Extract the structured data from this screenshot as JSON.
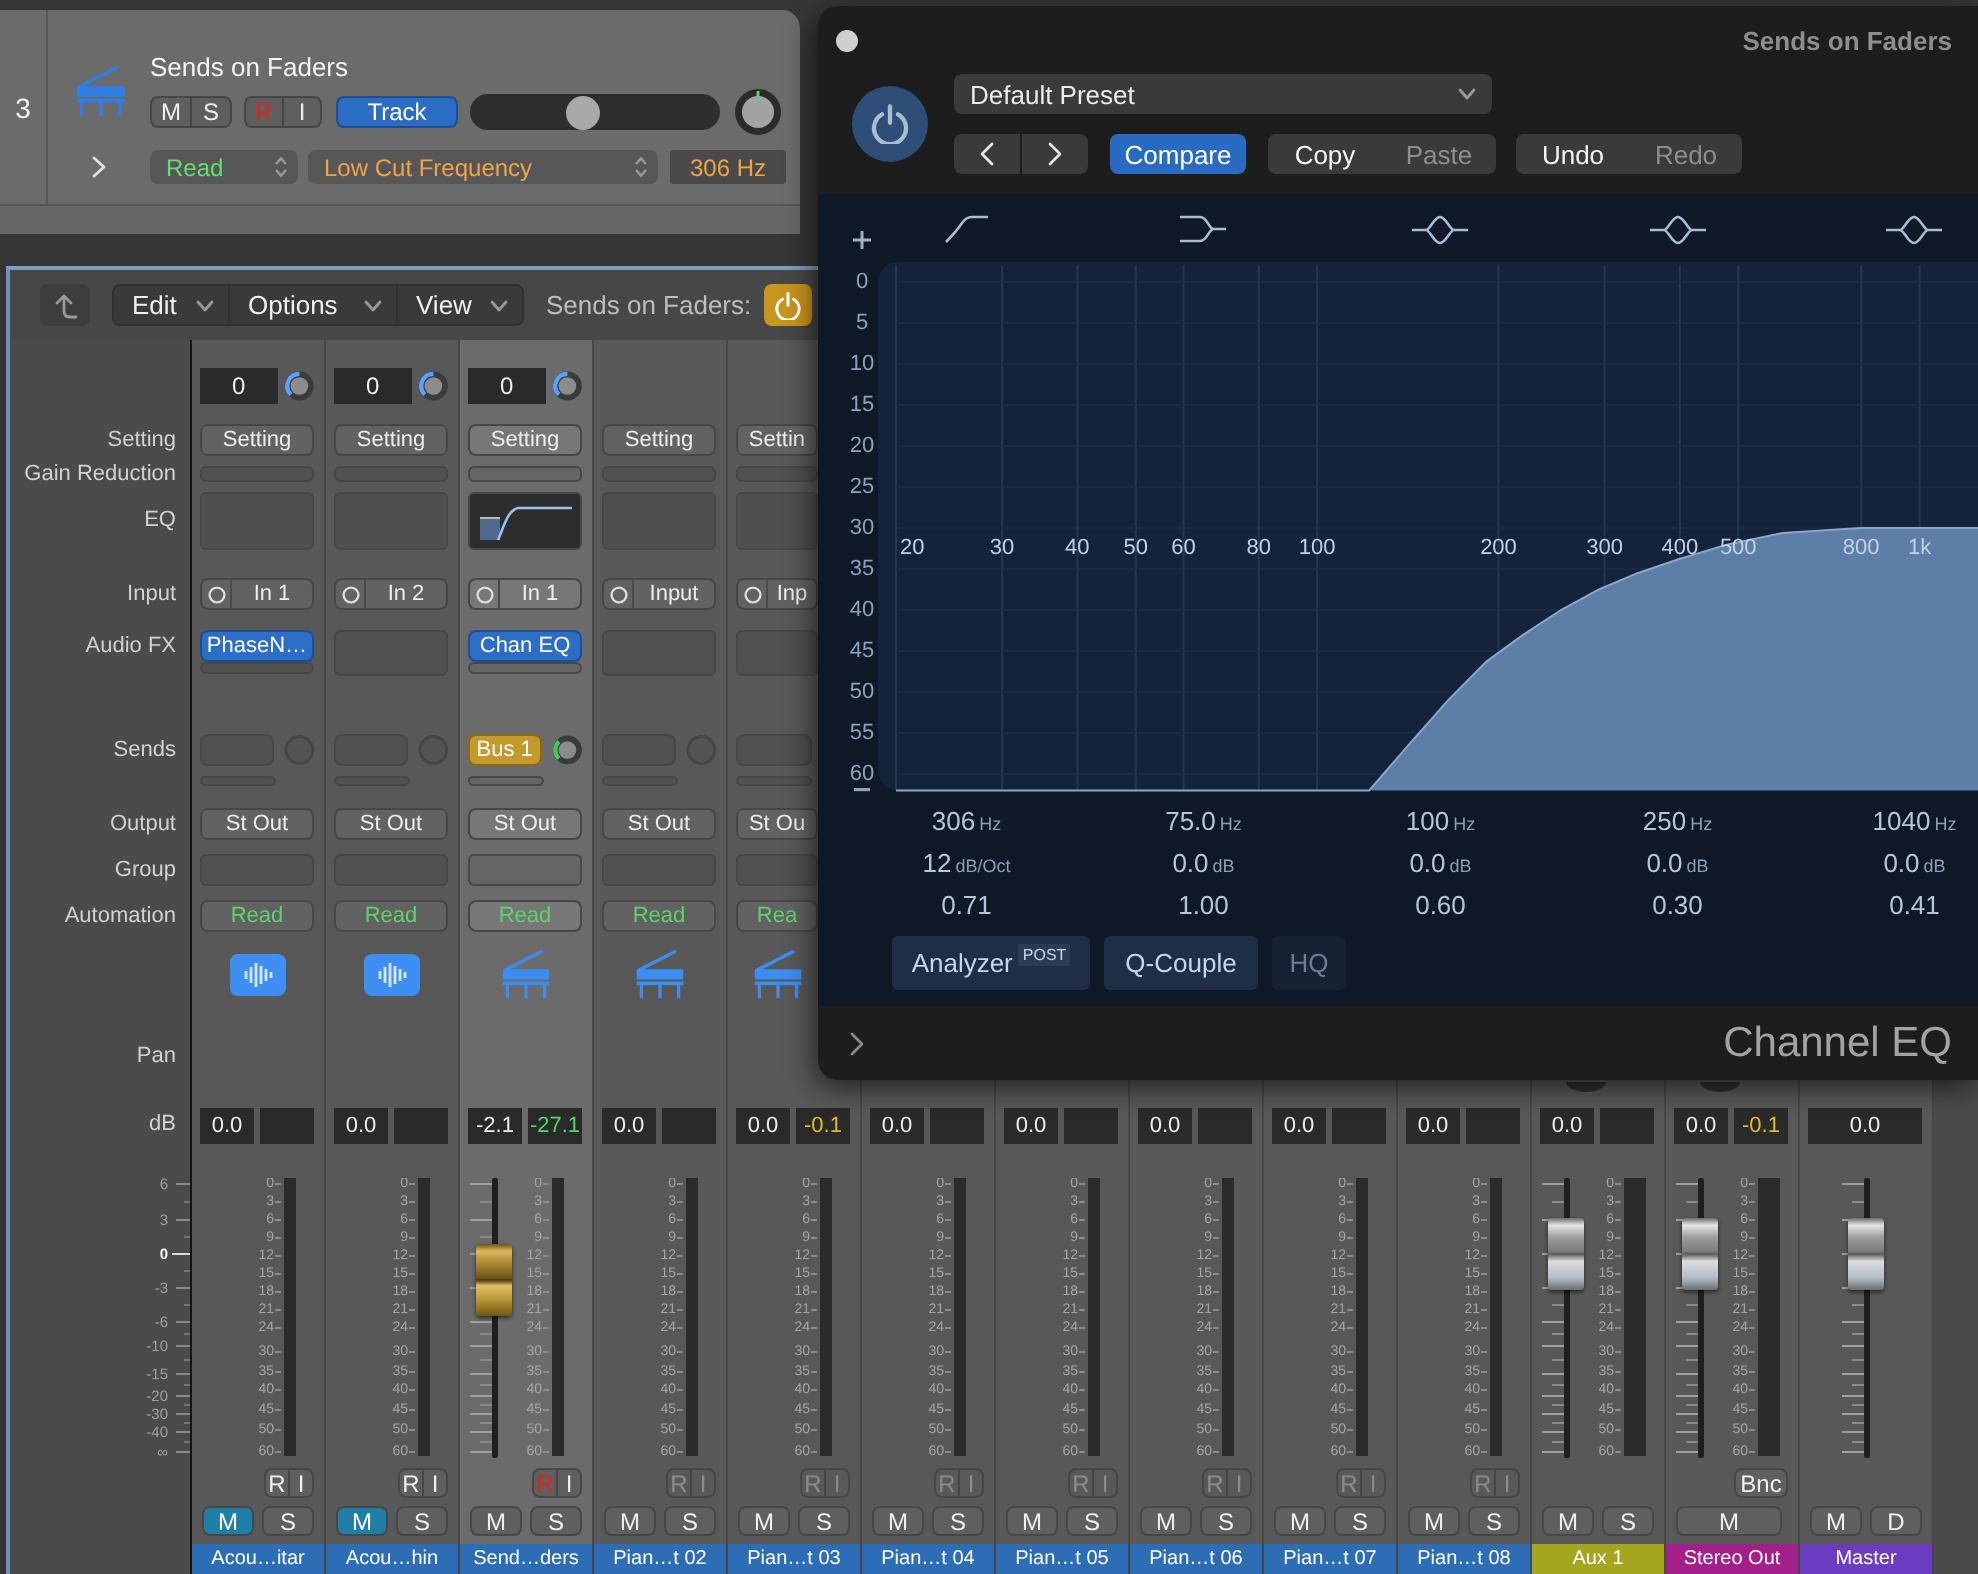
{
  "track": {
    "number": "3",
    "name": "Sends on Faders",
    "buttons": [
      {
        "kind": "mute",
        "label": "M",
        "on": false
      },
      {
        "kind": "solo",
        "label": "S",
        "on": false
      },
      {
        "kind": "record",
        "label": "R",
        "on": true
      },
      {
        "kind": "input_monitor",
        "label": "I",
        "on": false
      }
    ],
    "view_button": {
      "label": "Track",
      "on": true
    },
    "volume": {
      "level": 0.44
    },
    "automation_mode": "Read",
    "automation_parameter": "Low Cut Frequency",
    "automation_value": "306 Hz"
  },
  "mixer": {
    "toolbar": {
      "menus": [
        "Edit",
        "Options",
        "View"
      ],
      "sends_label": "Sends on Faders:",
      "sends_on_faders": true
    },
    "row_labels": [
      "Setting",
      "Gain Reduction",
      "EQ",
      "Input",
      "Audio FX",
      "Sends",
      "Output",
      "Group",
      "Automation",
      "Pan"
    ],
    "db_label": "dB",
    "fader_scale": [
      "6",
      "3",
      "0",
      "-3",
      "-6",
      "-10",
      "-15",
      "-20",
      "-30",
      "-40",
      "∞"
    ],
    "strips": [
      {
        "kind": "audio",
        "selected": false,
        "gain": "0",
        "setting": "Setting",
        "eq_thumbnail": false,
        "input": "In 1",
        "audio_fx": "PhaseN…",
        "output": "St Out",
        "automation": "Read",
        "db_value": "0.0",
        "meter_scale": [
          "0",
          "3",
          "6",
          "9",
          "12",
          "15",
          "18",
          "21",
          "24",
          "30",
          "35",
          "40",
          "45",
          "50",
          "60"
        ],
        "top_buttons": [
          {
            "kind": "record",
            "label": "R",
            "on": false,
            "disabled": false
          },
          {
            "kind": "input_monitor",
            "label": "I",
            "on": false,
            "disabled": false
          }
        ],
        "bottom_buttons": [
          {
            "kind": "mute",
            "label": "M",
            "on": true
          },
          {
            "kind": "solo",
            "label": "S",
            "on": false
          }
        ],
        "name": "Acou…itar",
        "color": "#2d6db5"
      },
      {
        "kind": "audio",
        "selected": false,
        "gain": "0",
        "setting": "Setting",
        "eq_thumbnail": false,
        "input": "In 2",
        "output": "St Out",
        "automation": "Read",
        "db_value": "0.0",
        "meter_scale": [
          "0",
          "3",
          "6",
          "9",
          "12",
          "15",
          "18",
          "21",
          "24",
          "30",
          "35",
          "40",
          "45",
          "50",
          "60"
        ],
        "top_buttons": [
          {
            "kind": "record",
            "label": "R",
            "on": false,
            "disabled": false
          },
          {
            "kind": "input_monitor",
            "label": "I",
            "on": false,
            "disabled": false
          }
        ],
        "bottom_buttons": [
          {
            "kind": "mute",
            "label": "M",
            "on": true
          },
          {
            "kind": "solo",
            "label": "S",
            "on": false
          }
        ],
        "name": "Acou…hin",
        "color": "#2d6db5"
      },
      {
        "kind": "instrument",
        "selected": true,
        "gain": "0",
        "setting": "Setting",
        "eq_thumbnail": true,
        "input": "In 1",
        "audio_fx": "Chan EQ",
        "send": "Bus 1",
        "output": "St Out",
        "automation": "Read",
        "db_value": "-2.1",
        "peak": {
          "value": "-27.1",
          "hot": false
        },
        "fader": {
          "kind": "send",
          "level": 0.68
        },
        "meter_scale": [
          "0",
          "3",
          "6",
          "9",
          "12",
          "15",
          "18",
          "21",
          "24",
          "30",
          "35",
          "40",
          "45",
          "50",
          "60"
        ],
        "top_buttons": [
          {
            "kind": "record",
            "label": "R",
            "on": true,
            "disabled": false
          },
          {
            "kind": "input_monitor",
            "label": "I",
            "on": false,
            "disabled": false
          }
        ],
        "bottom_buttons": [
          {
            "kind": "mute",
            "label": "M",
            "on": false
          },
          {
            "kind": "solo",
            "label": "S",
            "on": false
          }
        ],
        "name": "Send…ders",
        "color": "#2d6db5"
      },
      {
        "kind": "instrument",
        "selected": false,
        "setting": "Setting",
        "eq_thumbnail": false,
        "input": "Input",
        "output": "St Out",
        "automation": "Read",
        "db_value": "0.0",
        "meter_scale": [
          "0",
          "3",
          "6",
          "9",
          "12",
          "15",
          "18",
          "21",
          "24",
          "30",
          "35",
          "40",
          "45",
          "50",
          "60"
        ],
        "top_buttons": [
          {
            "kind": "record",
            "label": "R",
            "on": false,
            "disabled": true
          },
          {
            "kind": "input_monitor",
            "label": "I",
            "on": false,
            "disabled": true
          }
        ],
        "bottom_buttons": [
          {
            "kind": "mute",
            "label": "M",
            "on": false
          },
          {
            "kind": "solo",
            "label": "S",
            "on": false
          }
        ],
        "name": "Pian…t 02",
        "color": "#2d6db5"
      },
      {
        "kind": "instrument",
        "selected": false,
        "setting": "Settin",
        "eq_thumbnail": false,
        "input": "Inp",
        "output": "St Ou",
        "automation": "Rea",
        "db_value": "0.0",
        "peak": {
          "value": "-0.1",
          "hot": true
        },
        "meter_scale": [
          "0",
          "3",
          "6",
          "9",
          "12",
          "15",
          "18",
          "21",
          "24",
          "30",
          "35",
          "40",
          "45",
          "50",
          "60"
        ],
        "top_buttons": [
          {
            "kind": "record",
            "label": "R",
            "on": false,
            "disabled": true
          },
          {
            "kind": "input_monitor",
            "label": "I",
            "on": false,
            "disabled": true
          }
        ],
        "bottom_buttons": [
          {
            "kind": "mute",
            "label": "M",
            "on": false
          },
          {
            "kind": "solo",
            "label": "S",
            "on": false
          }
        ],
        "name": "Pian…t 03",
        "color": "#2d6db5"
      },
      {
        "kind": "instrument",
        "selected": false,
        "db_value": "0.0",
        "meter_scale": [
          "0",
          "3",
          "6",
          "9",
          "12",
          "15",
          "18",
          "21",
          "24",
          "30",
          "35",
          "40",
          "45",
          "50",
          "60"
        ],
        "top_buttons": [
          {
            "kind": "record",
            "label": "R",
            "on": false,
            "disabled": true
          },
          {
            "kind": "input_monitor",
            "label": "I",
            "on": false,
            "disabled": true
          }
        ],
        "bottom_buttons": [
          {
            "kind": "mute",
            "label": "M",
            "on": false
          },
          {
            "kind": "solo",
            "label": "S",
            "on": false
          }
        ],
        "name": "Pian…t 04",
        "color": "#2d6db5"
      },
      {
        "kind": "instrument",
        "selected": false,
        "db_value": "0.0",
        "meter_scale": [
          "0",
          "3",
          "6",
          "9",
          "12",
          "15",
          "18",
          "21",
          "24",
          "30",
          "35",
          "40",
          "45",
          "50",
          "60"
        ],
        "top_buttons": [
          {
            "kind": "record",
            "label": "R",
            "on": false,
            "disabled": true
          },
          {
            "kind": "input_monitor",
            "label": "I",
            "on": false,
            "disabled": true
          }
        ],
        "bottom_buttons": [
          {
            "kind": "mute",
            "label": "M",
            "on": false
          },
          {
            "kind": "solo",
            "label": "S",
            "on": false
          }
        ],
        "name": "Pian…t 05",
        "color": "#2d6db5"
      },
      {
        "kind": "instrument",
        "selected": false,
        "db_value": "0.0",
        "meter_scale": [
          "0",
          "3",
          "6",
          "9",
          "12",
          "15",
          "18",
          "21",
          "24",
          "30",
          "35",
          "40",
          "45",
          "50",
          "60"
        ],
        "top_buttons": [
          {
            "kind": "record",
            "label": "R",
            "on": false,
            "disabled": true
          },
          {
            "kind": "input_monitor",
            "label": "I",
            "on": false,
            "disabled": true
          }
        ],
        "bottom_buttons": [
          {
            "kind": "mute",
            "label": "M",
            "on": false
          },
          {
            "kind": "solo",
            "label": "S",
            "on": false
          }
        ],
        "name": "Pian…t 06",
        "color": "#2d6db5"
      },
      {
        "kind": "instrument",
        "selected": false,
        "db_value": "0.0",
        "meter_scale": [
          "0",
          "3",
          "6",
          "9",
          "12",
          "15",
          "18",
          "21",
          "24",
          "30",
          "35",
          "40",
          "45",
          "50",
          "60"
        ],
        "top_buttons": [
          {
            "kind": "record",
            "label": "R",
            "on": false,
            "disabled": true
          },
          {
            "kind": "input_monitor",
            "label": "I",
            "on": false,
            "disabled": true
          }
        ],
        "bottom_buttons": [
          {
            "kind": "mute",
            "label": "M",
            "on": false
          },
          {
            "kind": "solo",
            "label": "S",
            "on": false
          }
        ],
        "name": "Pian…t 07",
        "color": "#2d6db5"
      },
      {
        "kind": "instrument",
        "selected": false,
        "db_value": "0.0",
        "meter_scale": [
          "0",
          "3",
          "6",
          "9",
          "12",
          "15",
          "18",
          "21",
          "24",
          "30",
          "35",
          "40",
          "45",
          "50",
          "60"
        ],
        "top_buttons": [
          {
            "kind": "record",
            "label": "R",
            "on": false,
            "disabled": true
          },
          {
            "kind": "input_monitor",
            "label": "I",
            "on": false,
            "disabled": true
          }
        ],
        "bottom_buttons": [
          {
            "kind": "mute",
            "label": "M",
            "on": false
          },
          {
            "kind": "solo",
            "label": "S",
            "on": false
          }
        ],
        "name": "Pian…t 08",
        "color": "#2d6db5"
      },
      {
        "kind": "aux",
        "selected": false,
        "db_value": "0.0",
        "fader": {
          "kind": "volume",
          "level": 0.81
        },
        "meter_scale": [
          "0",
          "3",
          "6",
          "9",
          "12",
          "15",
          "18",
          "21",
          "24",
          "30",
          "35",
          "40",
          "45",
          "50",
          "60"
        ],
        "bottom_buttons": [
          {
            "kind": "mute",
            "label": "M",
            "on": false
          },
          {
            "kind": "solo",
            "label": "S",
            "on": false
          }
        ],
        "name": "Aux 1",
        "color": "#a4a61f"
      },
      {
        "kind": "output",
        "selected": false,
        "db_value": "0.0",
        "peak": {
          "value": "-0.1",
          "hot": true
        },
        "fader": {
          "kind": "volume",
          "level": 0.81
        },
        "meter_scale": [
          "0",
          "3",
          "6",
          "9",
          "12",
          "15",
          "18",
          "21",
          "24",
          "30",
          "35",
          "40",
          "45",
          "50",
          "60"
        ],
        "top_buttons": [
          {
            "kind": "bounce",
            "label": "Bnc",
            "on": false,
            "disabled": false
          }
        ],
        "bottom_buttons": [
          {
            "kind": "mute",
            "label": "M",
            "on": false
          }
        ],
        "name": "Stereo Out",
        "color": "#a3208a"
      },
      {
        "kind": "master",
        "selected": false,
        "db_value": "0.0",
        "fader": {
          "kind": "volume",
          "level": 0.81
        },
        "bottom_buttons": [
          {
            "kind": "mute",
            "label": "M",
            "on": false
          },
          {
            "kind": "dim",
            "label": "D",
            "on": false
          }
        ],
        "name": "Master",
        "color": "#6a3cc0"
      }
    ]
  },
  "plugin_window": {
    "title": "Sends on Faders",
    "power_on": true,
    "preset": "Default Preset",
    "compare": {
      "label": "Compare",
      "on": true
    },
    "clipboard": [
      {
        "label": "Copy",
        "disabled": false
      },
      {
        "label": "Paste",
        "disabled": true
      }
    ],
    "history": [
      {
        "label": "Undo",
        "disabled": false
      },
      {
        "label": "Redo",
        "disabled": true
      }
    ],
    "bands": [
      {
        "kind": "low_cut",
        "frequency": "306",
        "frequency_unit": "Hz",
        "gain": "12",
        "gain_unit": "dB/Oct",
        "q": "0.71"
      },
      {
        "kind": "low_shelf",
        "frequency": "75.0",
        "frequency_unit": "Hz",
        "gain": "0.0",
        "gain_unit": "dB",
        "q": "1.00"
      },
      {
        "kind": "peak",
        "frequency": "100",
        "frequency_unit": "Hz",
        "gain": "0.0",
        "gain_unit": "dB",
        "q": "0.60"
      },
      {
        "kind": "peak",
        "frequency": "250",
        "frequency_unit": "Hz",
        "gain": "0.0",
        "gain_unit": "dB",
        "q": "0.30"
      },
      {
        "kind": "peak",
        "frequency": "1040",
        "frequency_unit": "Hz",
        "gain": "0.0",
        "gain_unit": "dB",
        "q": "0.41"
      }
    ],
    "graph": {
      "level_labels": [
        "0",
        "5",
        "10",
        "15",
        "20",
        "25",
        "30",
        "35",
        "40",
        "45",
        "50",
        "55",
        "60"
      ],
      "frequency_labels": [
        "20",
        "30",
        "40",
        "50",
        "60",
        "80",
        "100",
        "200",
        "300",
        "400",
        "500",
        "800",
        "1k"
      ]
    },
    "options": [
      {
        "label": "Analyzer",
        "badge": "POST",
        "on": true
      },
      {
        "label": "Q-Couple",
        "on": true
      },
      {
        "label": "HQ",
        "on": false
      }
    ],
    "name": "Channel EQ"
  }
}
